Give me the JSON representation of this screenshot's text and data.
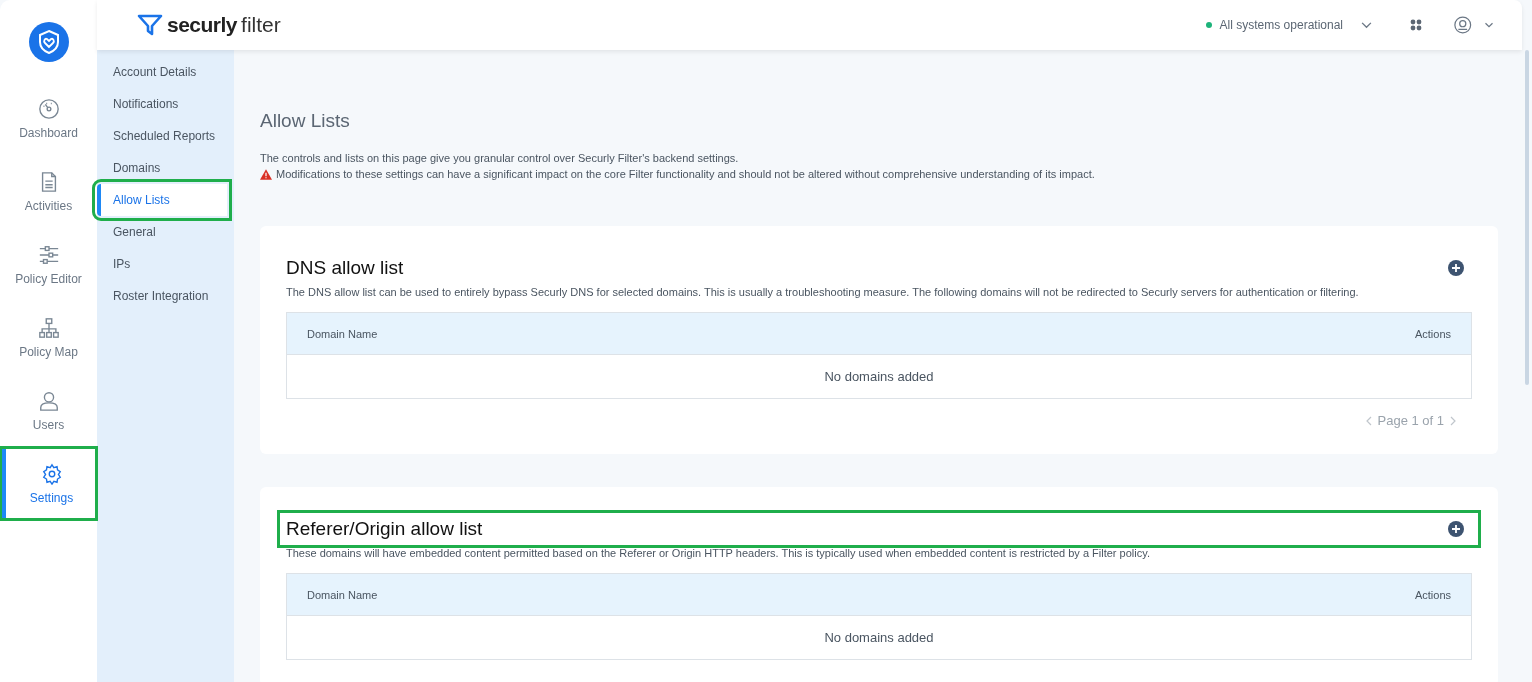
{
  "brand": {
    "name": "securly",
    "product": "filter"
  },
  "header": {
    "status": {
      "text": "All systems operational",
      "color": "#1db37a"
    }
  },
  "rail": [
    {
      "label": "Dashboard",
      "kind": "gauge",
      "selected": false,
      "highlighted": false
    },
    {
      "label": "Activities",
      "kind": "document",
      "selected": false,
      "highlighted": false
    },
    {
      "label": "Policy Editor",
      "kind": "sliders",
      "selected": false,
      "highlighted": false
    },
    {
      "label": "Policy Map",
      "kind": "hierarchy",
      "selected": false,
      "highlighted": false
    },
    {
      "label": "Users",
      "kind": "person",
      "selected": false,
      "highlighted": false
    },
    {
      "label": "Settings",
      "kind": "gear",
      "selected": true,
      "highlighted": true
    }
  ],
  "subnav": [
    {
      "label": "Account Details",
      "selected": false,
      "highlighted": false
    },
    {
      "label": "Notifications",
      "selected": false,
      "highlighted": false
    },
    {
      "label": "Scheduled Reports",
      "selected": false,
      "highlighted": false
    },
    {
      "label": "Domains",
      "selected": false,
      "highlighted": false
    },
    {
      "label": "Allow Lists",
      "selected": true,
      "highlighted": true
    },
    {
      "label": "General",
      "selected": false,
      "highlighted": false
    },
    {
      "label": "IPs",
      "selected": false,
      "highlighted": false
    },
    {
      "label": "Roster Integration",
      "selected": false,
      "highlighted": false
    }
  ],
  "page": {
    "title": "Allow Lists",
    "intro": "The controls and lists on this page give you granular control over Securly Filter's backend settings.",
    "warning": "Modifications to these settings can have a significant impact on the core Filter functionality and should not be altered without comprehensive understanding of its impact."
  },
  "sections": [
    {
      "title": "DNS allow list",
      "highlighted": false,
      "description": "The DNS allow list can be used to entirely bypass Securly DNS for selected domains. This is usually a troubleshooting measure. The following domains will not be redirected to Securly servers for authentication or filtering.",
      "columns": [
        "Domain Name",
        "Actions"
      ],
      "empty_text": "No domains added",
      "pagination": "Page 1 of 1"
    },
    {
      "title": "Referer/Origin allow list",
      "highlighted": true,
      "description": "These domains will have embedded content permitted based on the Referer or Origin HTTP headers. This is typically used when embedded content is restricted by a Filter policy.",
      "columns": [
        "Domain Name",
        "Actions"
      ],
      "empty_text": "No domains added"
    }
  ]
}
